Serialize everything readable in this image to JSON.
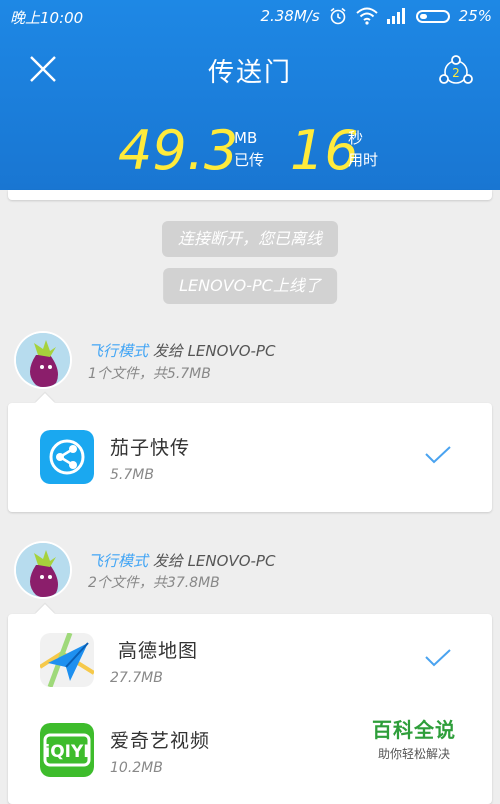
{
  "status_bar": {
    "time": "晚上10:00",
    "speed": "2.38M/s",
    "battery": "25%"
  },
  "header": {
    "title": "传送门",
    "share_badge": "2",
    "transferred_value": "49.3",
    "transferred_unit": "MB",
    "transferred_label": "已传",
    "time_value": "16",
    "time_unit": "秒",
    "time_label": "用时"
  },
  "notices": [
    "连接断开，您已离线",
    "LENOVO-PC上线了"
  ],
  "transfers": [
    {
      "sender": "飞行模式",
      "action": "发给 LENOVO-PC",
      "summary": "1个文件，共5.7MB",
      "files": [
        {
          "name": "茄子快传",
          "size": "5.7MB",
          "icon": "shareit-app-icon",
          "done": true
        }
      ]
    },
    {
      "sender": "飞行模式",
      "action": "发给 LENOVO-PC",
      "summary": "2个文件，共37.8MB",
      "files": [
        {
          "name": "高德地图",
          "size": "27.7MB",
          "icon": "amap-app-icon",
          "done": true
        },
        {
          "name": "爱奇艺视频",
          "size": "10.2MB",
          "icon": "iqiyi-app-icon",
          "done": false
        }
      ]
    }
  ],
  "watermark": {
    "title": "百科全说",
    "subtitle": "助你轻松解决"
  },
  "colors": {
    "header_blue": "#1e88e5",
    "stat_yellow": "#ffeb3b",
    "sender_blue": "#42a5f5",
    "check_blue": "#4aa3f0",
    "watermark_green": "#2e9e3a"
  }
}
